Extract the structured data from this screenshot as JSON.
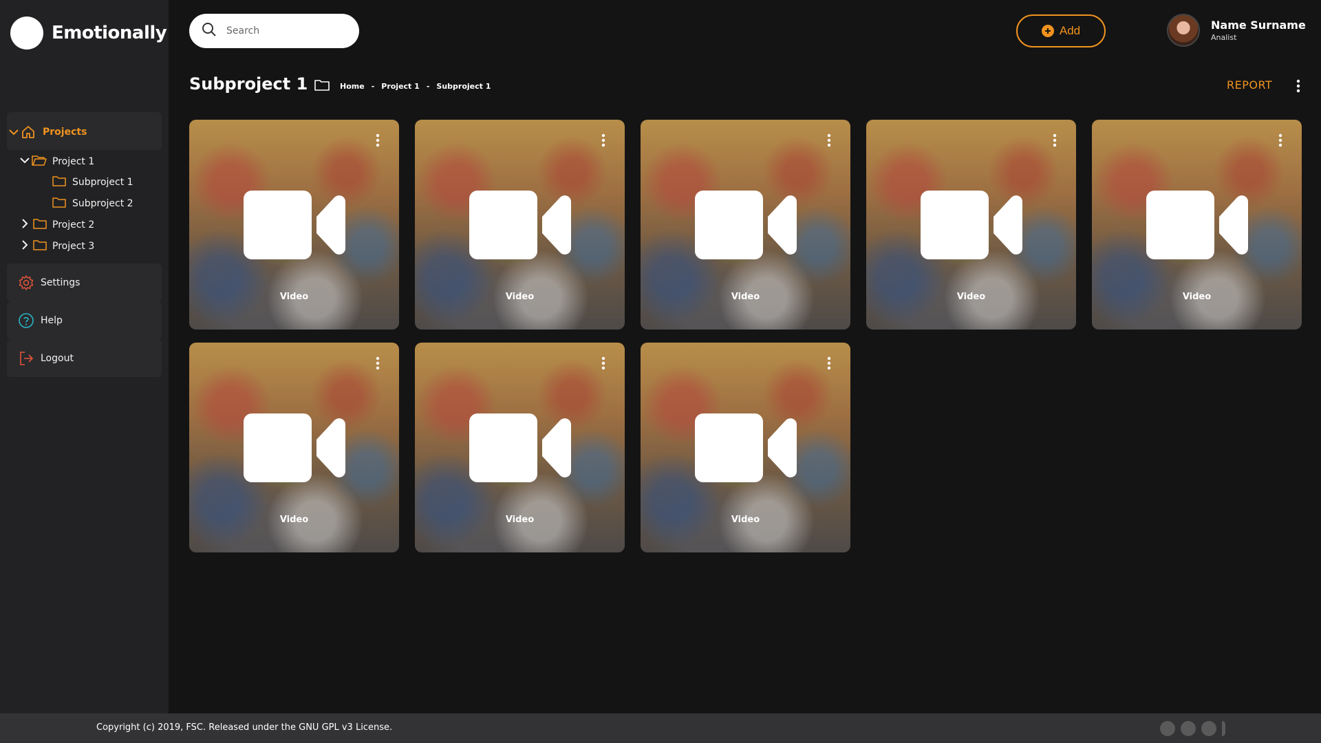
{
  "app": {
    "name": "Emotionally"
  },
  "search": {
    "placeholder": "Search"
  },
  "header": {
    "add_label": "Add"
  },
  "user": {
    "name": "Name Surname",
    "role": "Analist"
  },
  "sidebar": {
    "projects_label": "Projects",
    "tree": [
      {
        "label": "Project 1"
      },
      {
        "label": "Subproject 1"
      },
      {
        "label": "Subproject 2"
      },
      {
        "label": "Project 2"
      },
      {
        "label": "Project 3"
      }
    ],
    "settings_label": "Settings",
    "help_label": "Help",
    "logout_label": "Logout"
  },
  "page": {
    "title": "Subproject 1",
    "breadcrumb": [
      "Home",
      "Project 1",
      "Subproject 1"
    ],
    "breadcrumb_sep": "-",
    "report_label": "REPORT"
  },
  "videos": [
    {
      "label": "Video"
    },
    {
      "label": "Video"
    },
    {
      "label": "Video"
    },
    {
      "label": "Video"
    },
    {
      "label": "Video"
    },
    {
      "label": "Video"
    },
    {
      "label": "Video"
    },
    {
      "label": "Video"
    }
  ],
  "footer": {
    "copyright": "Copyright (c) 2019, FSC. Released under the GNU GPL v3 License."
  },
  "colors": {
    "accent": "#f0931e",
    "help": "#29b6c8",
    "danger": "#e2553a",
    "sidebar": "#222224",
    "background": "#141414"
  }
}
